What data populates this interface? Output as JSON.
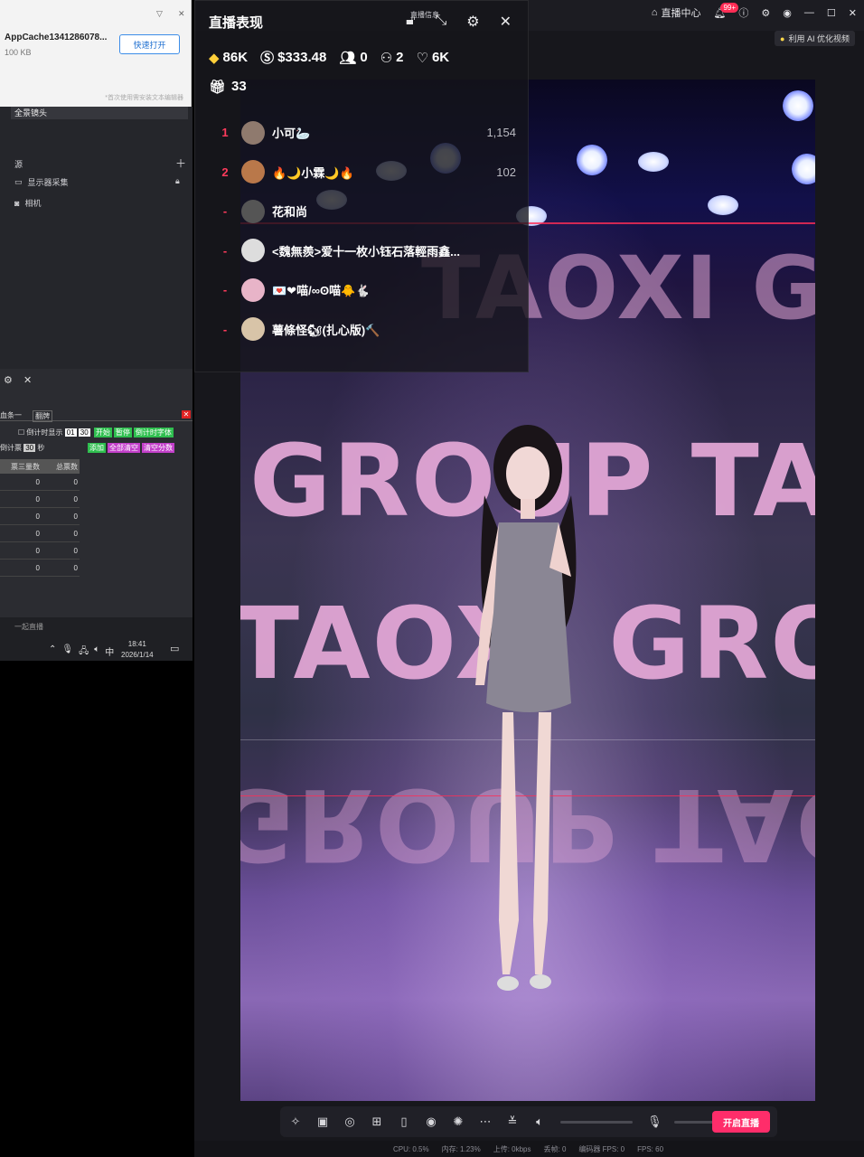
{
  "app": {
    "live_center": "直播中心",
    "notifications": "99+",
    "ai_tip": "利用 AI 优化视频"
  },
  "performance": {
    "title": "直播表现",
    "subtitle": "直播信息",
    "stats": {
      "diamonds": "86K",
      "earnings": "$333.48",
      "new_followers": "0",
      "viewers": "2",
      "likes": "6K",
      "gifts": "33"
    },
    "viewers": [
      {
        "rank": "1",
        "name": "小可🦢",
        "score": "1,154",
        "color": "#8f7a6e"
      },
      {
        "rank": "2",
        "name": "🔥🌙小霖🌙🔥",
        "score": "102",
        "color": "#b9784a"
      },
      {
        "rank": "-",
        "name": "花和尚",
        "score": "",
        "color": "#555"
      },
      {
        "rank": "-",
        "name": "<魏無羨>爱十一枚小钰石落輕雨鑫...",
        "score": "",
        "color": "#ddd"
      },
      {
        "rank": "-",
        "name": "💌❤喵/∞ʘ喵🐥🐇",
        "score": "",
        "color": "#e8b4c8"
      },
      {
        "rank": "-",
        "name": "薯條怪🐿(扎心版)🔨",
        "score": "",
        "color": "#d8c4a8"
      }
    ]
  },
  "preview": {
    "banner_words": [
      "TAOXI GROUP T",
      "GROUP TAOXI",
      "TAOXI GROUP",
      "GROUP TAOXI GROUP"
    ]
  },
  "toolbar": {
    "go_live": "开启直播"
  },
  "statusbar": {
    "cpu": "CPU: 0.5%",
    "memory": "内存: 1.23%",
    "upload": "上传: 0kbps",
    "dropped": "丢帧: 0",
    "encoder": "编码器 FPS: 0",
    "fps": "FPS: 60"
  },
  "download": {
    "filename": "AppCache1341286078...",
    "size": "100 KB",
    "open_button": "快速打开",
    "hint": "*首次使用需安装文本编辑器"
  },
  "left_panel": {
    "scene_label": "全景镜头",
    "sources_title": "源",
    "sources": [
      "显示器采集",
      "相机"
    ]
  },
  "counter": {
    "tab1": "血条一",
    "tab2": "翻牌",
    "row1_label": "倒计时显示",
    "row1_v1": "01",
    "row1_v2": "30",
    "btn_start": "开始",
    "btn_pause": "暂停",
    "btn_font": "倒计时字体",
    "row2_label": "倒计票",
    "row2_v": "30",
    "row2_unit": "秒",
    "btn_add": "添加",
    "btn_clear": "全部清空",
    "btn_clear_score": "清空分数",
    "col1": "票三量数",
    "col2": "总票数",
    "rows": [
      "0",
      "0",
      "0",
      "0",
      "0",
      "0"
    ]
  },
  "taskbar": {
    "time": "18:41",
    "date": "2026/1/14",
    "ime": "中",
    "app_label": "一起直播"
  }
}
